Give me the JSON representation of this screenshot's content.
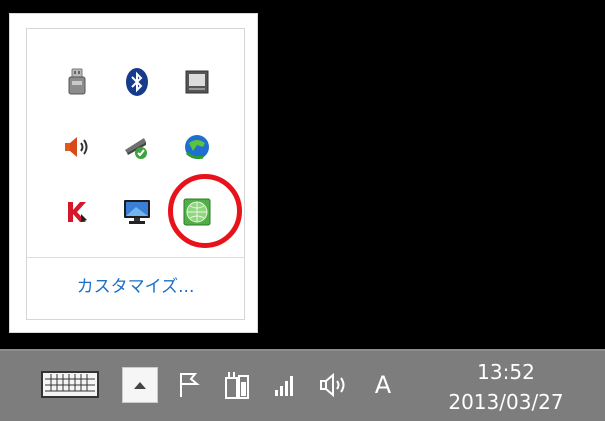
{
  "flyout": {
    "icons": [
      [
        "usb-icon",
        "bluetooth-icon",
        "window-icon"
      ],
      [
        "speaker-icon",
        "network-connected-icon",
        "globe-refresh-icon"
      ],
      [
        "kaspersky-icon",
        "monitor-icon",
        "green-globe-app-icon"
      ]
    ],
    "customize_label": "カスタマイズ..."
  },
  "taskbar": {
    "icons": [
      "touch-keyboard-icon",
      "show-hidden-icons-icon",
      "action-center-flag-icon",
      "battery-power-icon",
      "signal-strength-icon",
      "volume-icon"
    ],
    "ime_mode": "A",
    "clock": {
      "time": "13:52",
      "date": "2013/03/27"
    }
  },
  "colors": {
    "highlight": "#e8121a",
    "link": "#1e6fc6",
    "taskbar": "#7d7d7d"
  }
}
